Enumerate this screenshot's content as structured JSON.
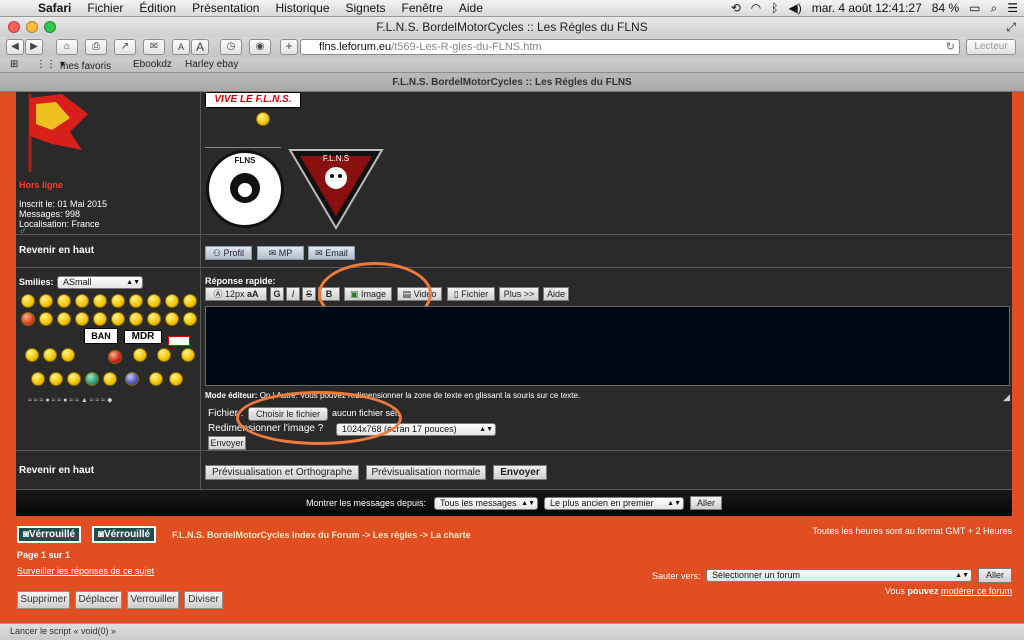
{
  "menubar": {
    "app": "Safari",
    "items": [
      "Fichier",
      "Édition",
      "Présentation",
      "Historique",
      "Signets",
      "Fenêtre",
      "Aide"
    ],
    "datetime": "mar. 4 août  12:41:27",
    "battery": "84 %"
  },
  "window": {
    "title": "F.L.N.S. BordelMotorCycles :: Les Régles du FLNS",
    "url_host": "flns.leforum.eu",
    "url_path": "/t569-Les-R-gles-du-FLNS.htm",
    "reader": "Lecteur",
    "tab_title": "F.L.N.S. BordelMotorCycles :: Les Régles du FLNS"
  },
  "bookmarks": [
    "mes favoris",
    "Ebookdz",
    "Harley ebay"
  ],
  "post": {
    "banner": "VIVE LE F.L.N.S.",
    "status": "Hors ligne",
    "joined": "Inscrit le: 01 Mai 2015",
    "messages": "Messages: 998",
    "location": "Localisation: France",
    "seal1": "FLNS",
    "seal2": "F.L.N.S"
  },
  "back_to_top": "Revenir en haut",
  "profile_buttons": [
    "Profil",
    "MP",
    "Email"
  ],
  "reply": {
    "smilies_label": "Smilies:",
    "smilies_select": "ASmall",
    "ban_label": "BAN",
    "mdr_label": "MDR",
    "title": "Réponse rapide:",
    "font_size": "12px",
    "buttons": [
      "G",
      "I",
      "S",
      "B",
      "Image",
      "Video",
      "Fichier",
      "Plus >>",
      "Aide"
    ],
    "mode_label": "Mode éditeur:",
    "mode_hint": "On | Autre: Vous pouvez redimensionner la zone de texte en glissant la souris sur ce texte.",
    "file_label": "Fichier :",
    "choose_file": "Choisir le fichier",
    "no_file": "aucun fichier sél.",
    "resize_label": "Redimensionner l'image ?",
    "resize_value": "1024x768 (écran 17 pouces)",
    "send_small": "Envoyer",
    "preview_spell": "Prévisualisation et Orthographe",
    "preview_normal": "Prévisualisation normale",
    "send": "Envoyer"
  },
  "filter": {
    "label": "Montrer les messages depuis:",
    "since": "Tous les messages",
    "order": "Le plus ancien en premier",
    "go": "Aller"
  },
  "footer": {
    "locked1": "Vérrouillé",
    "locked2": "Vérrouillé",
    "breadcrumb": "F.L.N.S. BordelMotorCycles Index du Forum -> Les règles -> La charte",
    "timezone": "Toutes les heures sont au format GMT + 2 Heures",
    "pages": "Page 1 sur 1",
    "watch": "Surveiller les réponses de ce sujet",
    "jump_label": "Sauter vers:",
    "jump_select": "Sélectionner un forum",
    "jump_go": "Aller",
    "moderate_prefix": "Vous ",
    "moderate_can": "pouvez",
    "moderate_link": "modérer ce forum",
    "mod_buttons": [
      "Supprimer",
      "Déplacer",
      "Verrouiller",
      "Diviser"
    ]
  },
  "status_bar": "Lancer le script « void(0) »",
  "colors": {
    "page_bg": "#e04e22",
    "forum_bg": "#2a2a2a",
    "editor_bg": "#000814",
    "highlight_ring": "#f07a3a"
  }
}
